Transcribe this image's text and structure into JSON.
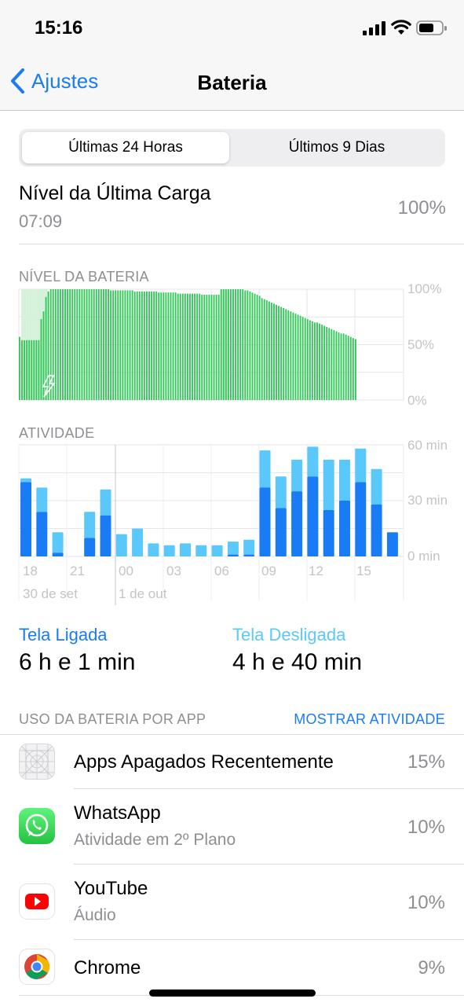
{
  "status": {
    "time": "15:16"
  },
  "nav": {
    "back_label": "Ajustes",
    "title": "Bateria"
  },
  "segments": {
    "selected": "Últimas 24 Horas",
    "other": "Últimos 9 Dias"
  },
  "last_charge": {
    "label": "Nível da Última Carga",
    "time": "07:09",
    "value": "100%"
  },
  "battery_level": {
    "header": "NÍVEL DA BATERIA",
    "axis": [
      "100%",
      "50%",
      "0%"
    ]
  },
  "activity": {
    "header": "ATIVIDADE",
    "axis": [
      "60 min",
      "30 min",
      "0 min"
    ],
    "x_ticks": [
      "18",
      "21",
      "00",
      "03",
      "06",
      "09",
      "12",
      "15"
    ],
    "dates": [
      "30 de set",
      "1 de out"
    ]
  },
  "screen": {
    "on_label": "Tela Ligada",
    "on_value": "6 h e 1 min",
    "off_label": "Tela Desligada",
    "off_value": "4 h e 40 min",
    "on_color": "#1a7cf5",
    "off_color": "#5ac8fa"
  },
  "app_usage": {
    "header": "USO DA BATERIA POR APP",
    "action": "MOSTRAR ATIVIDADE",
    "apps": [
      {
        "name": "Apps Apagados Recentemente",
        "sub": "",
        "pct": "15%",
        "icon": "deleted-apps-icon"
      },
      {
        "name": "WhatsApp",
        "sub": "Atividade em 2º Plano",
        "pct": "10%",
        "icon": "whatsapp-icon"
      },
      {
        "name": "YouTube",
        "sub": "Áudio",
        "pct": "10%",
        "icon": "youtube-icon"
      },
      {
        "name": "Chrome",
        "sub": "",
        "pct": "9%",
        "icon": "chrome-icon"
      }
    ]
  },
  "chart_data": [
    {
      "type": "bar",
      "title": "NÍVEL DA BATERIA",
      "ylabel": "",
      "ylim": [
        0,
        100
      ],
      "y_ticks": [
        "0%",
        "50%",
        "100%"
      ],
      "values": [
        57,
        54,
        54,
        54,
        54,
        54,
        54,
        54,
        54,
        73,
        80,
        93,
        98,
        100,
        100,
        100,
        100,
        100,
        100,
        100,
        100,
        100,
        100,
        100,
        100,
        100,
        100,
        100,
        100,
        100,
        100,
        100,
        100,
        100,
        100,
        100,
        100,
        100,
        99,
        99,
        99,
        99,
        99,
        99,
        99,
        99,
        99,
        99,
        98,
        98,
        98,
        98,
        98,
        98,
        98,
        98,
        98,
        98,
        97,
        97,
        97,
        97,
        97,
        97,
        97,
        97,
        96,
        96,
        96,
        96,
        96,
        96,
        96,
        96,
        96,
        96,
        95,
        95,
        95,
        95,
        95,
        95,
        95,
        95,
        100,
        100,
        100,
        100,
        100,
        100,
        100,
        100,
        100,
        100,
        99,
        99,
        98,
        97,
        96,
        95,
        94,
        92,
        91,
        90,
        89,
        88,
        87,
        86,
        85,
        84,
        83,
        82,
        81,
        80,
        79,
        78,
        77,
        76,
        75,
        74,
        73,
        72,
        71,
        70,
        70,
        69,
        68,
        67,
        66,
        65,
        64,
        63,
        62,
        61,
        60,
        60,
        59,
        58,
        57,
        56,
        55
      ],
      "charging": [
        0,
        1,
        1,
        1,
        1,
        1,
        1,
        1,
        1,
        1,
        1,
        1,
        0,
        0,
        0,
        0,
        0,
        0,
        0,
        0,
        0,
        0,
        0,
        0,
        0,
        0,
        0,
        0,
        0,
        0,
        0,
        0,
        0,
        0,
        0,
        0,
        0,
        0,
        0,
        0,
        0,
        0,
        0,
        0,
        0,
        0,
        0,
        0,
        0,
        0,
        0,
        0,
        0,
        0,
        0,
        0,
        0,
        0,
        0,
        0,
        0,
        0,
        0,
        0,
        0,
        0,
        0,
        0,
        0,
        0,
        0,
        0,
        0,
        0,
        0,
        0,
        0,
        0,
        0,
        0,
        0,
        0,
        0,
        0,
        1,
        1,
        1,
        0,
        0,
        0,
        0,
        0,
        0,
        0,
        0,
        0,
        0,
        0,
        0,
        0,
        0,
        0,
        0,
        0,
        0,
        0,
        0,
        0,
        0,
        0,
        0,
        0,
        0,
        0,
        0,
        0,
        0,
        0,
        0,
        0,
        0,
        0,
        0,
        0,
        0,
        0,
        0,
        0,
        0,
        0,
        0,
        0,
        0,
        0,
        0,
        0,
        0,
        0,
        0,
        0,
        0,
        0,
        0
      ]
    },
    {
      "type": "bar",
      "title": "ATIVIDADE",
      "ylabel": "",
      "ylim": [
        0,
        60
      ],
      "y_ticks": [
        "0 min",
        "30 min",
        "60 min"
      ],
      "x_ticks": [
        "18",
        "21",
        "00",
        "03",
        "06",
        "09",
        "12",
        "15"
      ],
      "series": [
        {
          "name": "Tela Ligada",
          "values": [
            40,
            24,
            2,
            0,
            10,
            22,
            0,
            0,
            0,
            0,
            0,
            0,
            0,
            1,
            1,
            37,
            26,
            35,
            43,
            25,
            30,
            40,
            28,
            13
          ]
        },
        {
          "name": "Tela Desligada",
          "values": [
            2,
            13,
            11,
            0,
            14,
            14,
            12,
            15,
            7,
            6,
            7,
            6,
            6,
            7,
            8,
            20,
            17,
            17,
            16,
            27,
            22,
            18,
            19,
            0
          ]
        }
      ]
    }
  ]
}
